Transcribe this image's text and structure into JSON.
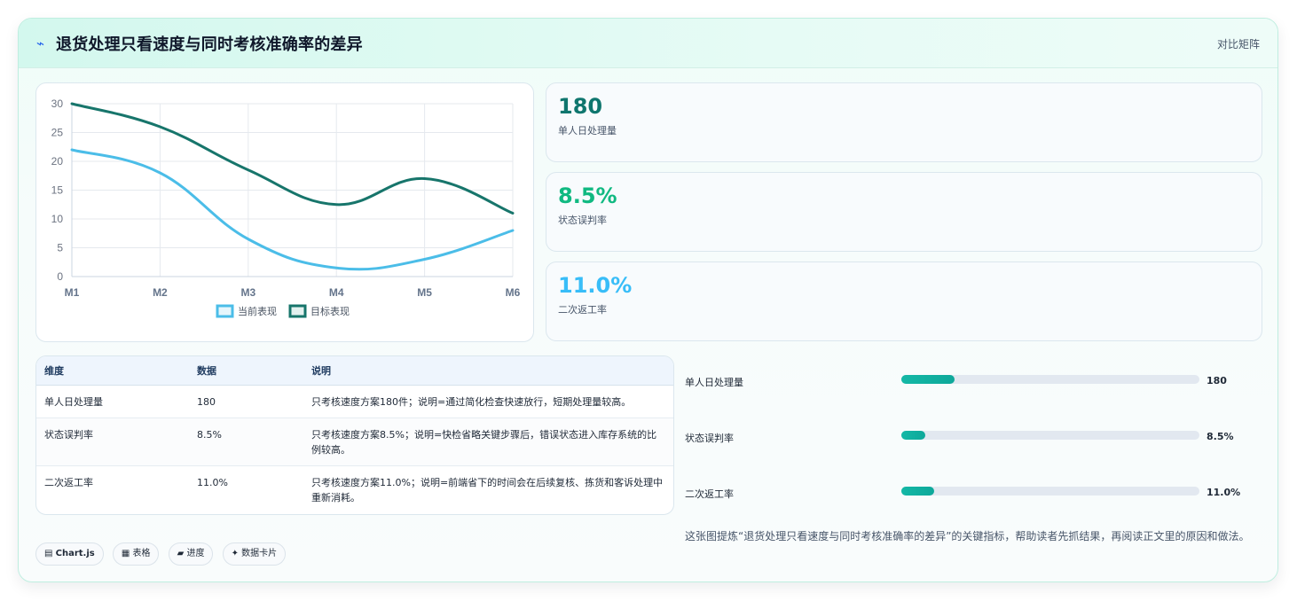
{
  "header": {
    "icon": "⌁",
    "title": "退货处理只看速度与同时考核准确率的差异",
    "action": "对比矩阵"
  },
  "chart_data": {
    "type": "line",
    "x": [
      "M1",
      "M2",
      "M3",
      "M4",
      "M5",
      "M6"
    ],
    "ylim": [
      0,
      30
    ],
    "yticks": [
      0,
      5,
      10,
      15,
      20,
      25,
      30
    ],
    "grid": true,
    "legend_position": "bottom",
    "series": [
      {
        "name": "当前表现",
        "color": "#4bbde8",
        "values": [
          22,
          18,
          6.5,
          1.5,
          3,
          8
        ]
      },
      {
        "name": "目标表现",
        "color": "#17756b",
        "values": [
          30,
          26,
          18.5,
          12.5,
          17,
          11
        ]
      }
    ]
  },
  "kpis": [
    {
      "value": "180",
      "label": "单人日处理量",
      "color": "#0f766e"
    },
    {
      "value": "8.5%",
      "label": "状态误判率",
      "color": "#10b981"
    },
    {
      "value": "11.0%",
      "label": "二次返工率",
      "color": "#38bdf8"
    }
  ],
  "table": {
    "headers": [
      "维度",
      "数据",
      "说明"
    ],
    "rows": [
      [
        "单人日处理量",
        "180",
        "只考核速度方案180件；说明=通过简化检查快速放行，短期处理量较高。"
      ],
      [
        "状态误判率",
        "8.5%",
        "只考核速度方案8.5%；说明=快检省略关键步骤后，错误状态进入库存系统的比例较高。"
      ],
      [
        "二次返工率",
        "11.0%",
        "只考核速度方案11.0%；说明=前端省下的时间会在后续复核、拣货和客诉处理中重新消耗。"
      ]
    ]
  },
  "progress": [
    {
      "label": "单人日处理量",
      "value": "180",
      "fill": 0.18
    },
    {
      "label": "状态误判率",
      "value": "8.5%",
      "fill": 0.08
    },
    {
      "label": "二次返工率",
      "value": "11.0%",
      "fill": 0.11
    }
  ],
  "description": "这张图提炼“退货处理只看速度与同时考核准确率的差异”的关键指标，帮助读者先抓结果，再阅读正文里的原因和做法。",
  "tags": [
    {
      "icon": "▤",
      "label": "Chart.js"
    },
    {
      "icon": "▦",
      "label": "表格"
    },
    {
      "icon": "▰",
      "label": "进度"
    },
    {
      "icon": "✦",
      "label": "数据卡片"
    }
  ]
}
